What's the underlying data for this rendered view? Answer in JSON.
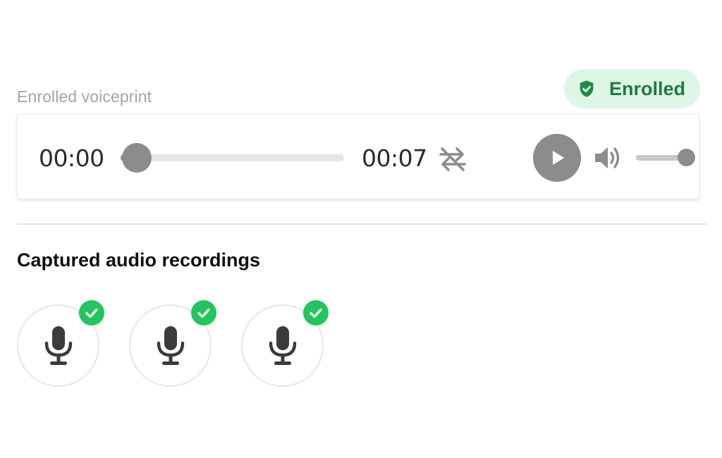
{
  "voiceprint": {
    "section_label": "Enrolled voiceprint",
    "status_badge": {
      "label": "Enrolled",
      "icon": "shield-check-icon",
      "color": "#1f7a3f",
      "background": "#ddf6e6"
    },
    "player": {
      "current_time": "00:00",
      "duration": "00:07",
      "progress": 0.07,
      "volume": 1.0,
      "controls": [
        "loop-off-icon",
        "play-icon",
        "volume-icon"
      ]
    }
  },
  "recordings": {
    "title": "Captured audio recordings",
    "items": [
      {
        "icon": "microphone-icon",
        "status": "check-icon",
        "status_color": "#22c55e"
      },
      {
        "icon": "microphone-icon",
        "status": "check-icon",
        "status_color": "#22c55e"
      },
      {
        "icon": "microphone-icon",
        "status": "check-icon",
        "status_color": "#22c55e"
      }
    ]
  }
}
